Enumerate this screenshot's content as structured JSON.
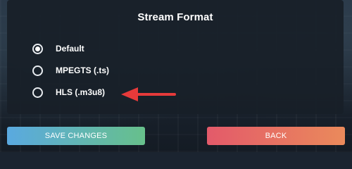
{
  "dialog": {
    "title": "Stream Format",
    "options": [
      {
        "label": "Default",
        "selected": true
      },
      {
        "label": "MPEGTS (.ts)",
        "selected": false
      },
      {
        "label": "HLS (.m3u8)",
        "selected": false
      }
    ]
  },
  "annotation": {
    "arrow_icon": "left-arrow-icon",
    "arrow_color": "#e63a3a"
  },
  "buttons": {
    "save_label": "SAVE CHANGES",
    "back_label": "BACK"
  },
  "colors": {
    "save_gradient": [
      "#5aa9e0",
      "#67c08b"
    ],
    "back_gradient": [
      "#e35a6a",
      "#ea8a5b"
    ]
  }
}
